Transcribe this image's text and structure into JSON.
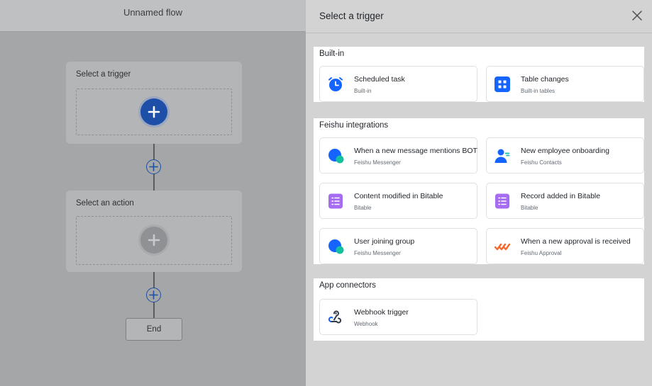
{
  "canvas": {
    "title": "Unnamed flow",
    "trigger_node_label": "Select a trigger",
    "action_node_label": "Select an action",
    "end_label": "End"
  },
  "drawer": {
    "title": "Select a trigger",
    "sections": [
      {
        "title": "Built-in",
        "cards": [
          {
            "title": "Scheduled task",
            "subtitle": "Built-in",
            "icon": "alarm-clock-icon"
          },
          {
            "title": "Table changes",
            "subtitle": "Built-in tables",
            "icon": "grid-icon"
          }
        ]
      },
      {
        "title": "Feishu integrations",
        "cards": [
          {
            "title": "When a new message mentions BOT",
            "subtitle": "Feishu Messenger",
            "icon": "messenger-icon"
          },
          {
            "title": "New employee onboarding",
            "subtitle": "Feishu Contacts",
            "icon": "contacts-icon"
          },
          {
            "title": "Content modified in Bitable",
            "subtitle": "Bitable",
            "icon": "bitable-icon"
          },
          {
            "title": "Record added in Bitable",
            "subtitle": "Bitable",
            "icon": "bitable-icon"
          },
          {
            "title": "User joining group",
            "subtitle": "Feishu Messenger",
            "icon": "messenger-icon"
          },
          {
            "title": "When a new approval is received",
            "subtitle": "Feishu Approval",
            "icon": "approval-icon"
          }
        ]
      },
      {
        "title": "App connectors",
        "cards": [
          {
            "title": "Webhook trigger",
            "subtitle": "Webhook",
            "icon": "webhook-icon"
          }
        ]
      }
    ]
  },
  "colors": {
    "accent_blue": "#1664ff",
    "bitable_purple": "#a56cf2",
    "approval_orange": "#f5692c",
    "teal": "#14c0a0"
  }
}
